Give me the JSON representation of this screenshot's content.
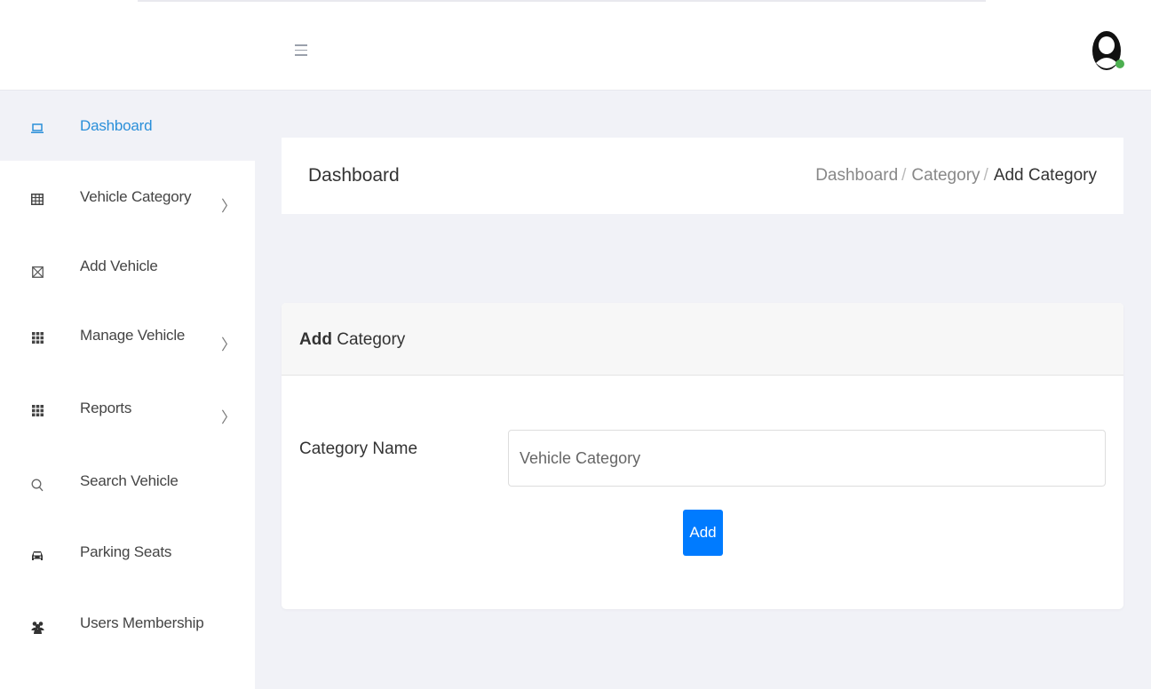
{
  "header": {
    "menu_icon": "hamburger-icon",
    "avatar_icon": "user-avatar-icon",
    "status_color": "#4caf50"
  },
  "sidebar": {
    "items": [
      {
        "label": "Dashboard",
        "icon": "laptop-icon",
        "active": true
      },
      {
        "label": "Vehicle Category",
        "icon": "table-icon",
        "has_submenu": true
      },
      {
        "label": "Add Vehicle",
        "icon": "envelope-box-icon"
      },
      {
        "label": "Manage Vehicle",
        "icon": "grid-icon",
        "has_submenu": true
      },
      {
        "label": "Reports",
        "icon": "grid-icon",
        "has_submenu": true
      },
      {
        "label": "Search Vehicle",
        "icon": "search-icon"
      },
      {
        "label": "Parking Seats",
        "icon": "car-icon"
      },
      {
        "label": "Users Membership",
        "icon": "users-icon"
      }
    ],
    "submenu_chevron": "〉"
  },
  "page_header": {
    "title": "Dashboard",
    "breadcrumb": [
      "Dashboard",
      "Category",
      "Add Category"
    ],
    "separator": "/"
  },
  "card": {
    "title_bold": "Add",
    "title_rest": " Category",
    "field_label": "Category Name",
    "field_placeholder": "Vehicle Category",
    "field_value": "",
    "submit_label": "Add"
  },
  "colors": {
    "accent": "#2a8fd9",
    "button": "#007bff",
    "background": "#f1f2f7"
  }
}
